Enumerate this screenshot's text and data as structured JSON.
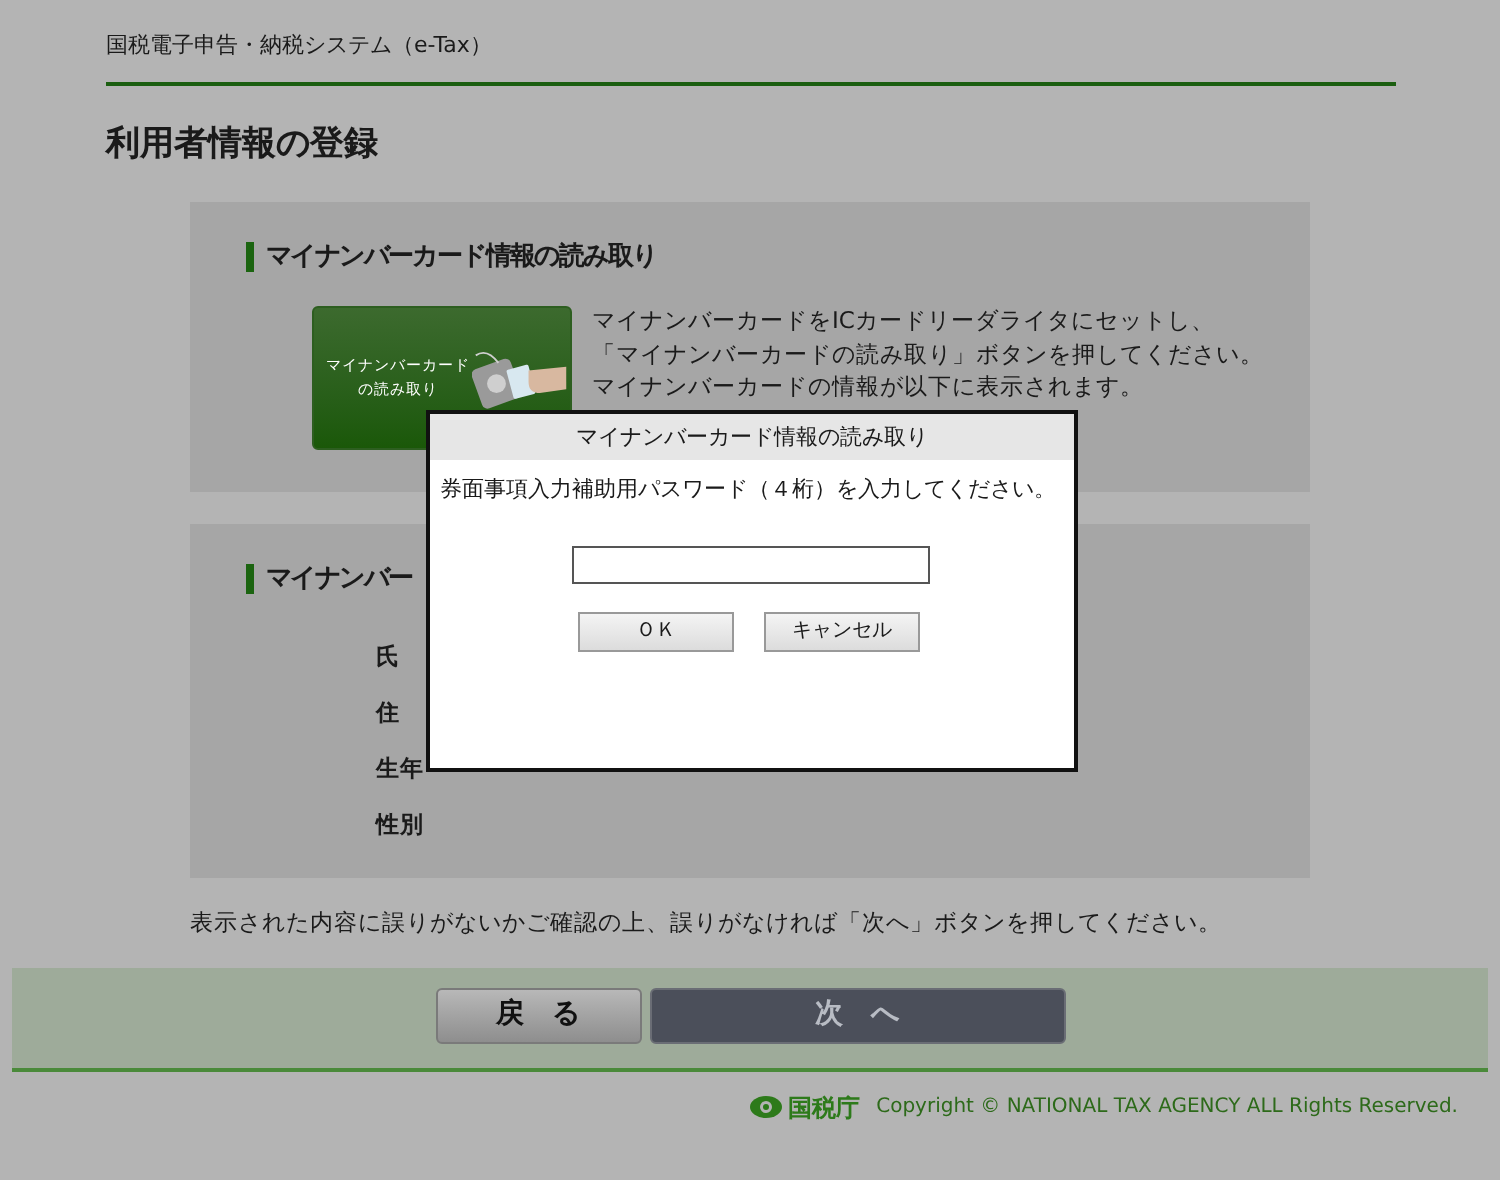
{
  "header": {
    "system_name": "国税電子申告・納税システム（e-Tax）"
  },
  "page_title": "利用者情報の登録",
  "card_section": {
    "heading": "マイナンバーカード情報の読み取り",
    "read_button": [
      "マイナンバーカード",
      "の読み取り"
    ],
    "instructions": [
      "マイナンバーカードをICカードリーダライタにセットし、",
      "「マイナンバーカードの読み取り」ボタンを押してください。",
      "マイナンバーカードの情報が以下に表示されます。"
    ]
  },
  "info_section": {
    "heading": "マイナンバー",
    "fields": [
      {
        "label": "氏"
      },
      {
        "label": "住"
      },
      {
        "label": "生年"
      },
      {
        "label": "性別"
      }
    ]
  },
  "confirm_note": "表示された内容に誤りがないかご確認の上、誤りがなければ「次へ」ボタンを押してください。",
  "nav_buttons": [
    {
      "label": "戻　る",
      "kind": "back"
    },
    {
      "label": "次　へ",
      "kind": "next"
    }
  ],
  "footer": {
    "agency": "国税庁",
    "copyright": "Copyright © NATIONAL TAX AGENCY ALL Rights Reserved."
  },
  "dialog": {
    "title": "マイナンバーカード情報の読み取り",
    "message": "券面事項入力補助用パスワード（４桁）を入力してください。",
    "buttons": [
      "ＯＫ",
      "キャンセル"
    ]
  }
}
